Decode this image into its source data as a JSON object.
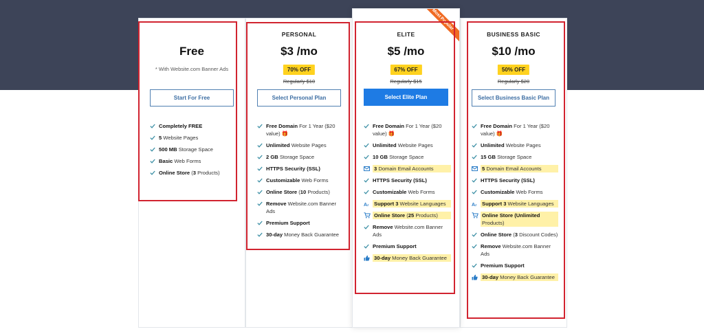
{
  "ribbon_label": "Most Popular",
  "plans": {
    "free": {
      "name": "",
      "price": "Free",
      "note": "* With Website.com Banner Ads",
      "button": "Start For Free",
      "features": [
        {
          "bold": "Completely FREE",
          "rest": ""
        },
        {
          "bold": "5",
          "rest": " Website Pages"
        },
        {
          "bold": "500 MB",
          "rest": " Storage Space"
        },
        {
          "bold": "Basic",
          "rest": " Web Forms"
        },
        {
          "bold": "Online Store",
          "rest": " (",
          "bold2": "3",
          "rest2": " Products)"
        }
      ]
    },
    "personal": {
      "name": "PERSONAL",
      "price": "$3 /mo",
      "discount": "70% OFF",
      "regular": "Regularly $10",
      "button": "Select Personal Plan",
      "features": [
        {
          "bold": "Free Domain",
          "rest": " For 1 Year ($20 value) 🎁"
        },
        {
          "bold": "Unlimited",
          "rest": " Website Pages"
        },
        {
          "bold": "2 GB",
          "rest": " Storage Space"
        },
        {
          "bold": "HTTPS Security (SSL)",
          "rest": ""
        },
        {
          "bold": "Customizable",
          "rest": " Web Forms"
        },
        {
          "bold": "Online Store",
          "rest": " (",
          "bold2": "10",
          "rest2": " Products)"
        },
        {
          "bold": "Remove",
          "rest": " Website.com Banner Ads"
        },
        {
          "bold": "Premium Support",
          "rest": ""
        },
        {
          "bold": "30-day",
          "rest": " Money Back Guarantee"
        }
      ]
    },
    "elite": {
      "name": "ELITE",
      "price": "$5 /mo",
      "discount": "67% OFF",
      "regular": "Regularly $15",
      "button": "Select Elite Plan",
      "features": [
        {
          "bold": "Free Domain",
          "rest": " For 1 Year ($20 value) 🎁"
        },
        {
          "bold": "Unlimited",
          "rest": " Website Pages"
        },
        {
          "bold": "10 GB",
          "rest": " Storage Space"
        },
        {
          "bold": "3",
          "rest": " Domain Email Accounts"
        },
        {
          "bold": "HTTPS Security (SSL)",
          "rest": ""
        },
        {
          "bold": "Customizable",
          "rest": " Web Forms"
        },
        {
          "bold": "Support 3",
          "rest": " Website Languages"
        },
        {
          "bold": "Online Store",
          "rest": " (",
          "bold2": "25",
          "rest2": " Products)"
        },
        {
          "bold": "Remove",
          "rest": " Website.com Banner Ads"
        },
        {
          "bold": "Premium Support",
          "rest": ""
        },
        {
          "bold": "30-day",
          "rest": " Money Back Guarantee"
        }
      ]
    },
    "business": {
      "name": "BUSINESS BASIC",
      "price": "$10 /mo",
      "discount": "50% OFF",
      "regular": "Regularly $20",
      "button": "Select Business Basic Plan",
      "features": [
        {
          "bold": "Free Domain",
          "rest": " For 1 Year ($20 value) 🎁"
        },
        {
          "bold": "Unlimited",
          "rest": " Website Pages"
        },
        {
          "bold": "15 GB",
          "rest": " Storage Space"
        },
        {
          "bold": "5",
          "rest": " Domain Email Accounts"
        },
        {
          "bold": "HTTPS Security (SSL)",
          "rest": ""
        },
        {
          "bold": "Customizable",
          "rest": " Web Forms"
        },
        {
          "bold": "Support 3",
          "rest": " Website Languages"
        },
        {
          "bold": "Online Store (Unlimited",
          "rest": " Products)"
        },
        {
          "bold": "Online Store",
          "rest": " (",
          "bold2": "3",
          "rest2": " Discount Codes)"
        },
        {
          "bold": "Remove",
          "rest": " Website.com Banner Ads"
        },
        {
          "bold": "Premium Support",
          "rest": ""
        },
        {
          "bold": "30-day",
          "rest": " Money Back Guarantee"
        }
      ]
    }
  },
  "colors": {
    "header_band": "#3d4458",
    "highlight": "#fff1a8",
    "badge": "#ffd21f",
    "primary_button": "#1e7be4",
    "check": "#3b8fa5",
    "ribbon": "#f06a22",
    "annotation_box": "#d1232f"
  }
}
